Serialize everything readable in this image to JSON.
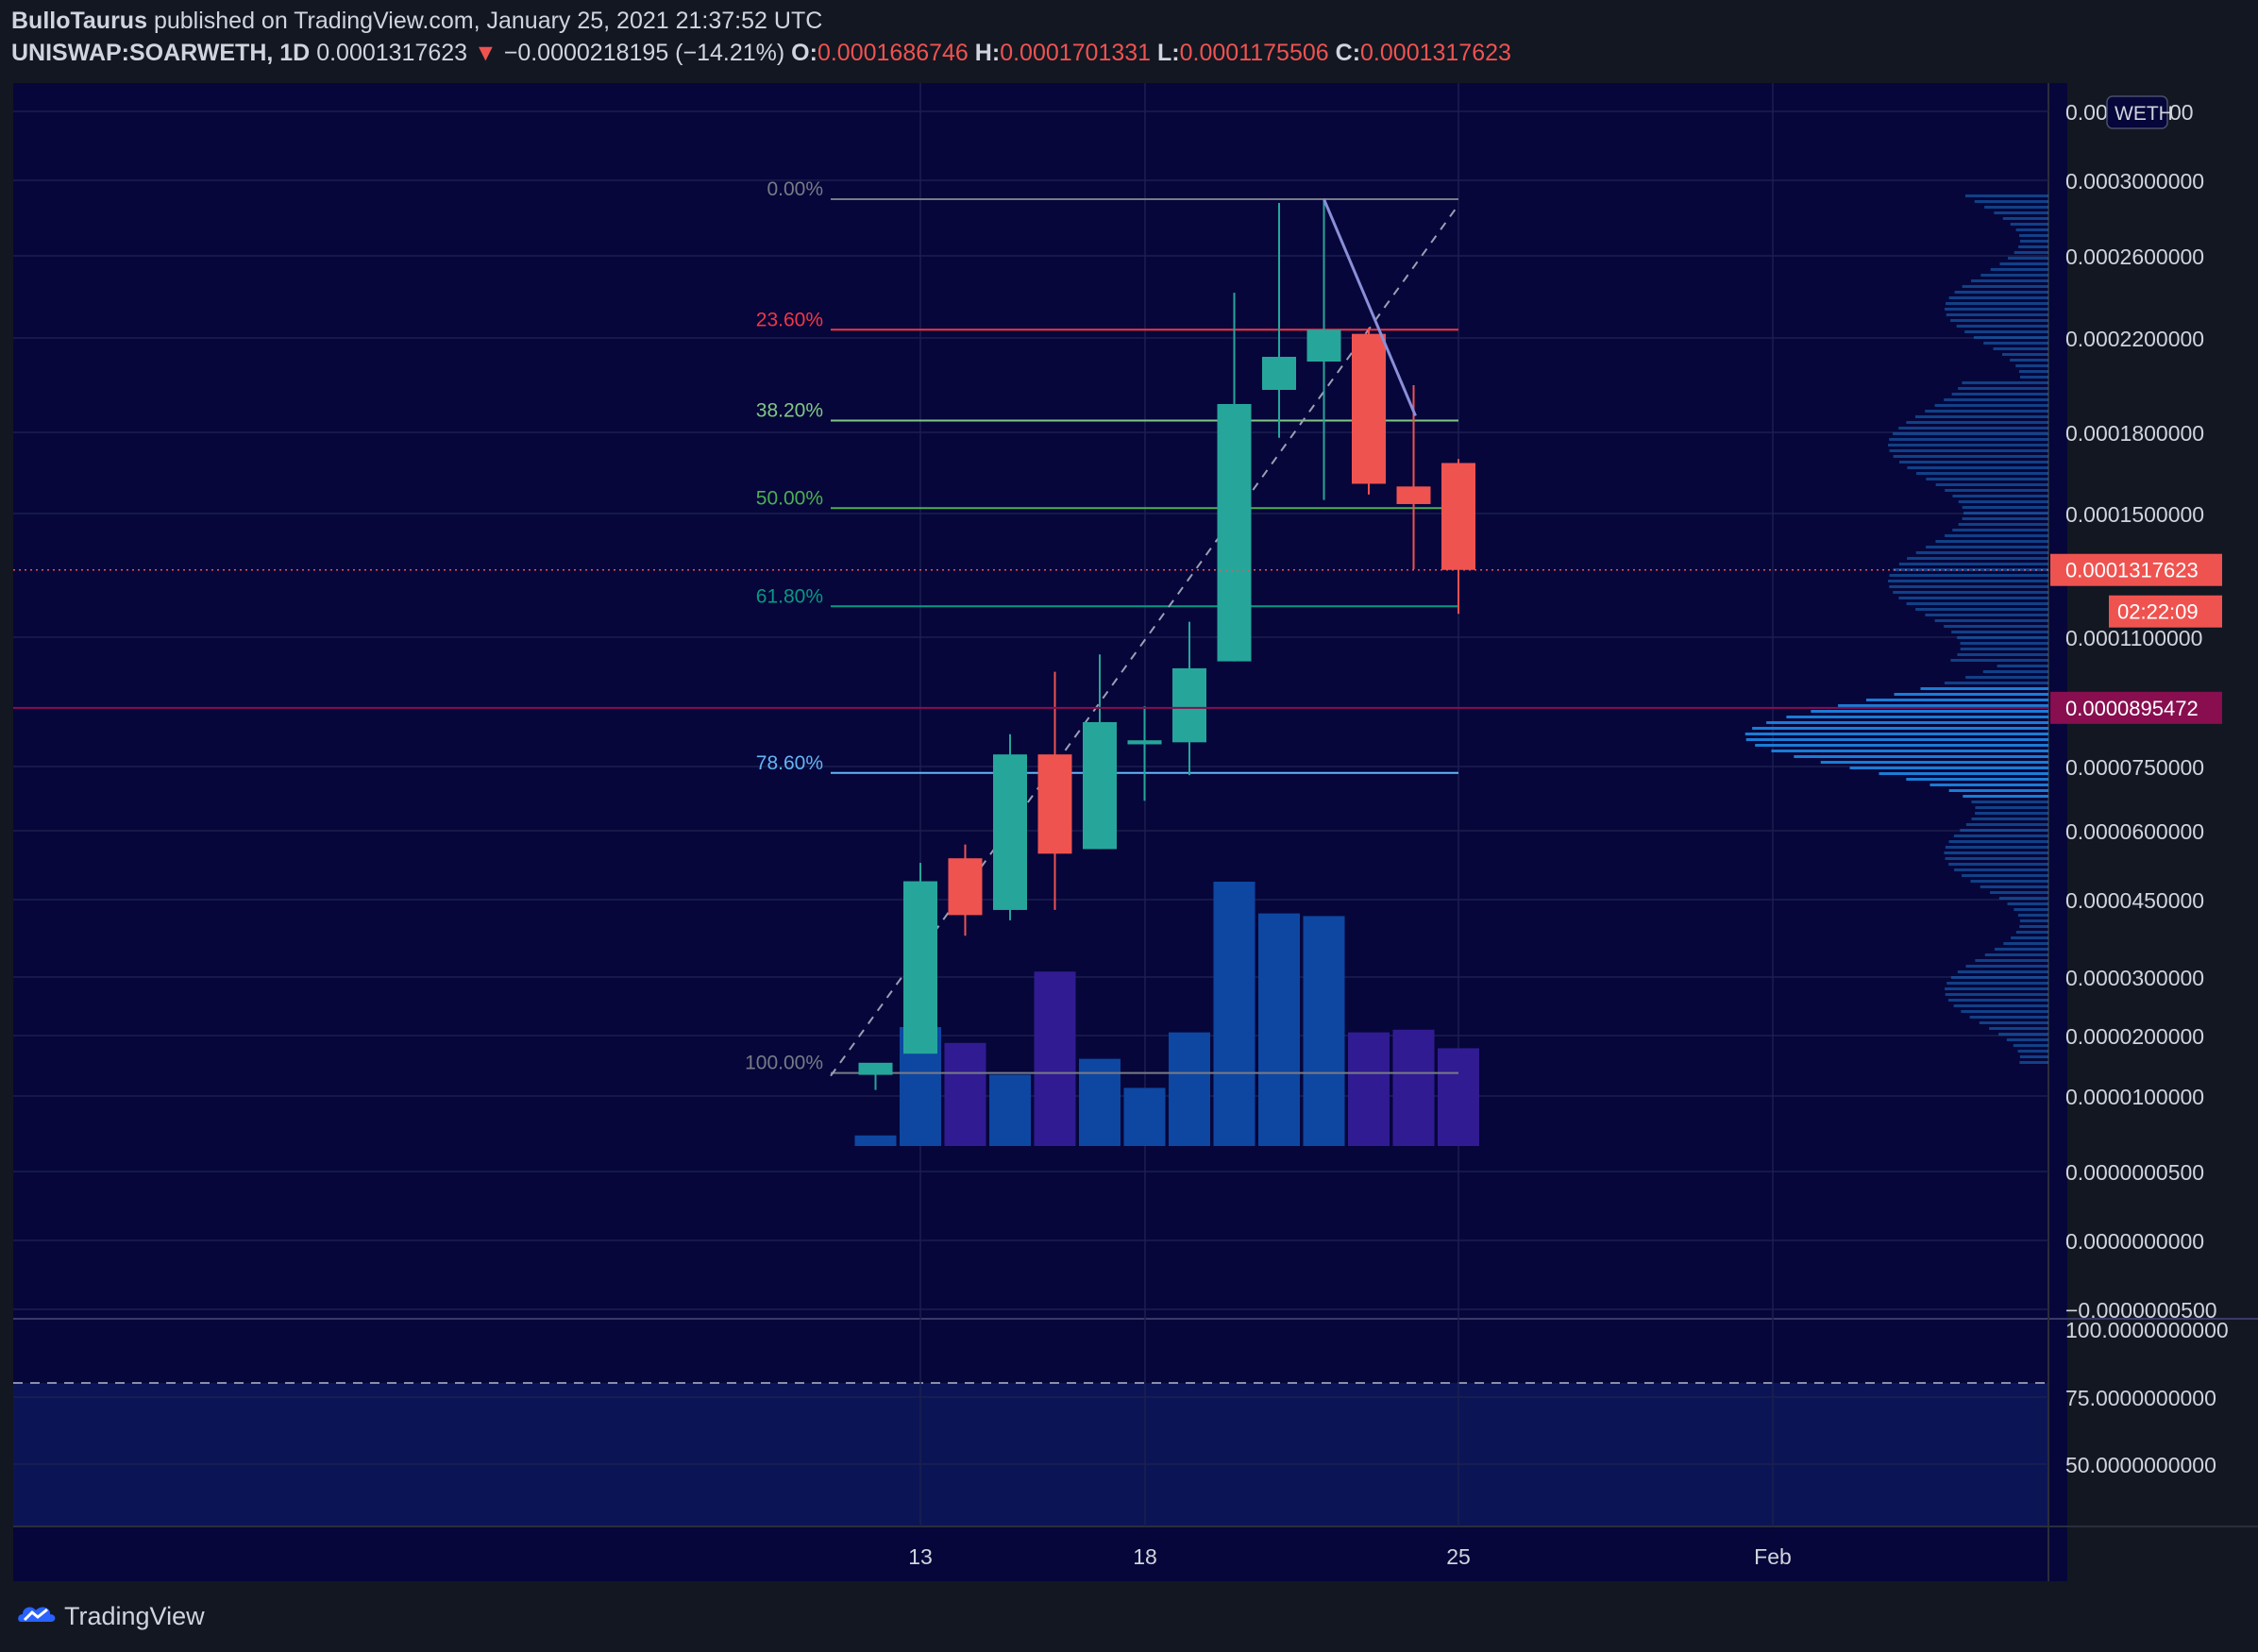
{
  "header": {
    "author": "BulloTaurus",
    "published_text": "published on TradingView.com, January 25, 2021 21:37:52 UTC",
    "symbol": "UNISWAP:SOARWETH, 1D",
    "price": "0.0001317623",
    "direction_glyph": "▼",
    "change": "−0.0000218195 (−14.21%)",
    "o_label": "O:",
    "o_value": "0.0001686746",
    "h_label": "H:",
    "h_value": "0.0001701331",
    "l_label": "L:",
    "l_value": "0.0001175506",
    "c_label": "C:",
    "c_value": "0.0001317623"
  },
  "footer": {
    "brand": "TradingView"
  },
  "colors": {
    "background": "#06063a",
    "up": "#26a69a",
    "down": "#ef5350",
    "volume_blue": "#0d47a1",
    "volume_purple": "#311b92",
    "profile": "#1e88e5"
  },
  "chart_data": {
    "type": "candlestick",
    "title": "",
    "currency_badge": "WETH",
    "x_ticks": [
      "13",
      "18",
      "25",
      "Feb"
    ],
    "y_ticks": [
      "0.0002600000",
      "0.0002200000",
      "0.0001800000",
      "0.0001500000",
      "0.0001100000",
      "0.0000750000",
      "0.0000600000",
      "0.0000450000",
      "0.0000300000",
      "0.0000200000",
      "0.0000100000",
      "0.0000000500",
      "0.0000000000",
      "−0.0000000500"
    ],
    "y_tick_top": "0.0003000000",
    "y_tick_clipped": "0.00",
    "y_tick_clipped_tail": "00",
    "last_price_label": "0.0001317623",
    "countdown": "02:22:09",
    "poc_label": "0.0000895472",
    "lower_pane_ticks": [
      "100.0000000000",
      "75.0000000000",
      "50.0000000000"
    ],
    "candles": [
      {
        "date": "2021-01-12",
        "open": 1.35e-05,
        "high": 1.5e-05,
        "low": 1.1e-05,
        "close": 1.55e-05
      },
      {
        "date": "2021-01-13",
        "open": 1.7e-05,
        "high": 5.3e-05,
        "low": 4e-05,
        "close": 4.9e-05
      },
      {
        "date": "2021-01-14",
        "open": 5.4e-05,
        "high": 5.7e-05,
        "low": 3.8e-05,
        "close": 4.2e-05
      },
      {
        "date": "2021-01-15",
        "open": 4.3e-05,
        "high": 8.3e-05,
        "low": 4.1e-05,
        "close": 7.8e-05
      },
      {
        "date": "2021-01-16",
        "open": 7.8e-05,
        "high": 0.0001,
        "low": 4.3e-05,
        "close": 5.5e-05
      },
      {
        "date": "2021-01-17",
        "open": 5.6e-05,
        "high": 0.000105,
        "low": 5.6e-05,
        "close": 8.6e-05
      },
      {
        "date": "2021-01-18",
        "open": 8.05e-05,
        "high": 9e-05,
        "low": 6.7e-05,
        "close": 8.15e-05
      },
      {
        "date": "2021-01-19",
        "open": 8.1e-05,
        "high": 0.000115,
        "low": 7.3e-05,
        "close": 0.000101
      },
      {
        "date": "2021-01-20",
        "open": 0.000103,
        "high": 0.000242,
        "low": 0.000103,
        "close": 0.000192
      },
      {
        "date": "2021-01-21",
        "open": 0.000198,
        "high": 0.000288,
        "low": 0.000178,
        "close": 0.000212
      },
      {
        "date": "2021-01-22",
        "open": 0.00021,
        "high": 0.00029,
        "low": 0.000155,
        "close": 0.000224
      },
      {
        "date": "2021-01-23",
        "open": 0.000222,
        "high": 0.000225,
        "low": 0.000157,
        "close": 0.000161
      },
      {
        "date": "2021-01-24",
        "open": 0.00016,
        "high": 0.0002,
        "low": 0.000132,
        "close": 0.0001535
      },
      {
        "date": "2021-01-25",
        "open": 0.0001686746,
        "high": 0.0001701331,
        "low": 0.0001175506,
        "close": 0.0001317623
      }
    ],
    "volume_relative": [
      0.04,
      0.45,
      0.39,
      0.27,
      0.66,
      0.33,
      0.22,
      0.43,
      1.0,
      0.88,
      0.87,
      0.43,
      0.44,
      0.37
    ],
    "fibonacci": {
      "levels": [
        {
          "label": "0.00%",
          "value": 0.00029,
          "color": "#787b86"
        },
        {
          "label": "23.60%",
          "value": 0.000224,
          "color": "#f23645"
        },
        {
          "label": "38.20%",
          "value": 0.000185,
          "color": "#81c784"
        },
        {
          "label": "50.00%",
          "value": 0.000152,
          "color": "#4caf50"
        },
        {
          "label": "61.80%",
          "value": 0.00012,
          "color": "#089981"
        },
        {
          "label": "78.60%",
          "value": 7.35e-05,
          "color": "#64b5f6"
        },
        {
          "label": "100.00%",
          "value": 1.38e-05,
          "color": "#787b86"
        }
      ],
      "anchor_start_date": "2021-01-12",
      "anchor_end_date": "2021-01-25"
    },
    "trend_line": {
      "from": {
        "date": "2021-01-22",
        "value": 0.00029
      },
      "to": {
        "date": "2021-01-24",
        "value": 0.000187
      }
    },
    "poc_value": 8.95472e-05
  }
}
